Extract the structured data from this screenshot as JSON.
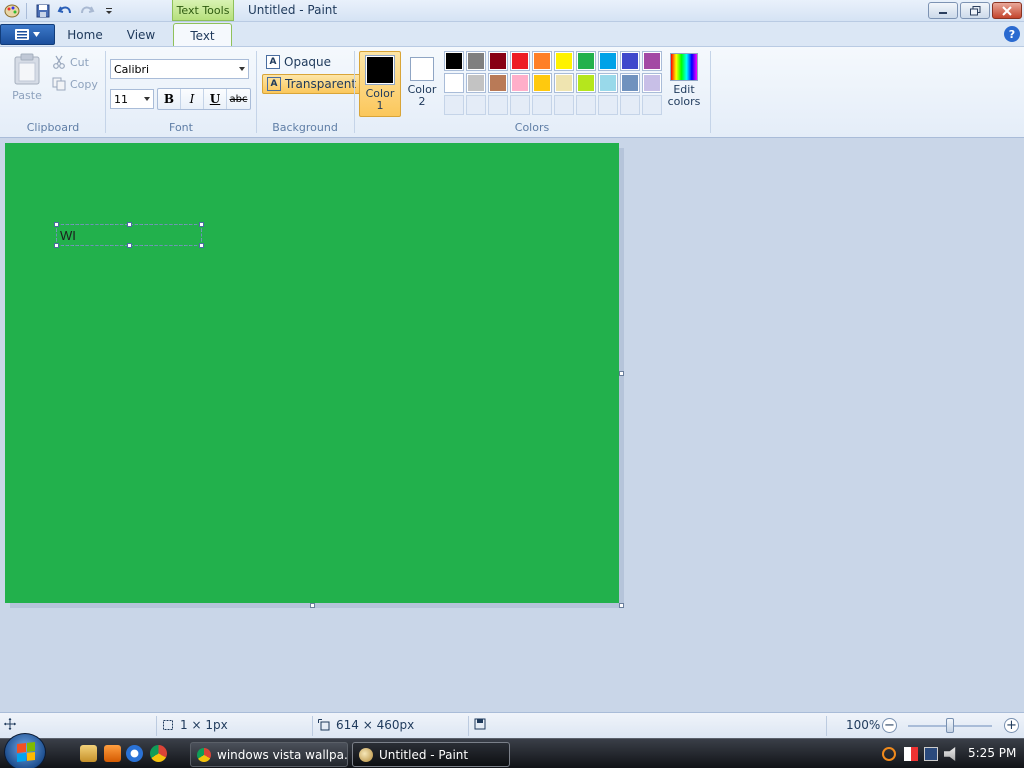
{
  "window": {
    "title": "Untitled - Paint",
    "contextual_tab": "Text Tools"
  },
  "tabs": {
    "home": "Home",
    "view": "View",
    "text": "Text"
  },
  "ribbon": {
    "clipboard": {
      "label": "Clipboard",
      "paste": "Paste",
      "cut": "Cut",
      "copy": "Copy"
    },
    "font": {
      "label": "Font",
      "family": "Calibri",
      "size": "11",
      "bold": "B",
      "italic": "I",
      "underline": "U",
      "strike": "abc"
    },
    "background": {
      "label": "Background",
      "opaque": "Opaque",
      "transparent": "Transparent",
      "selected": "Transparent"
    },
    "colors": {
      "label": "Colors",
      "color1_label": "Color 1",
      "color2_label": "Color 2",
      "color1": "#000000",
      "color2": "#ffffff",
      "edit_colors": "Edit colors",
      "palette": [
        "#000000",
        "#7f7f7f",
        "#880015",
        "#ed1c24",
        "#ff7f27",
        "#fff200",
        "#22b14c",
        "#00a2e8",
        "#3f48cc",
        "#a349a4",
        "#ffffff",
        "#c3c3c3",
        "#b97a57",
        "#ffaec9",
        "#ffc90e",
        "#efe4b0",
        "#b5e61d",
        "#99d9ea",
        "#7092be",
        "#c8bfe7",
        "",
        "",
        "",
        "",
        "",
        "",
        "",
        "",
        "",
        ""
      ]
    }
  },
  "canvas": {
    "background": "#22b14c",
    "text_entry": "WI"
  },
  "status": {
    "cursor_pos": "",
    "selection_size": "1 × 1px",
    "image_size": "614 × 460px",
    "zoom": "100%"
  },
  "taskbar": {
    "tasks": [
      {
        "label": "windows vista wallpa...",
        "icon": "chrome-icon",
        "active": false
      },
      {
        "label": "Untitled - Paint",
        "icon": "paint-icon",
        "active": true
      }
    ],
    "clock": "5:25 PM"
  }
}
